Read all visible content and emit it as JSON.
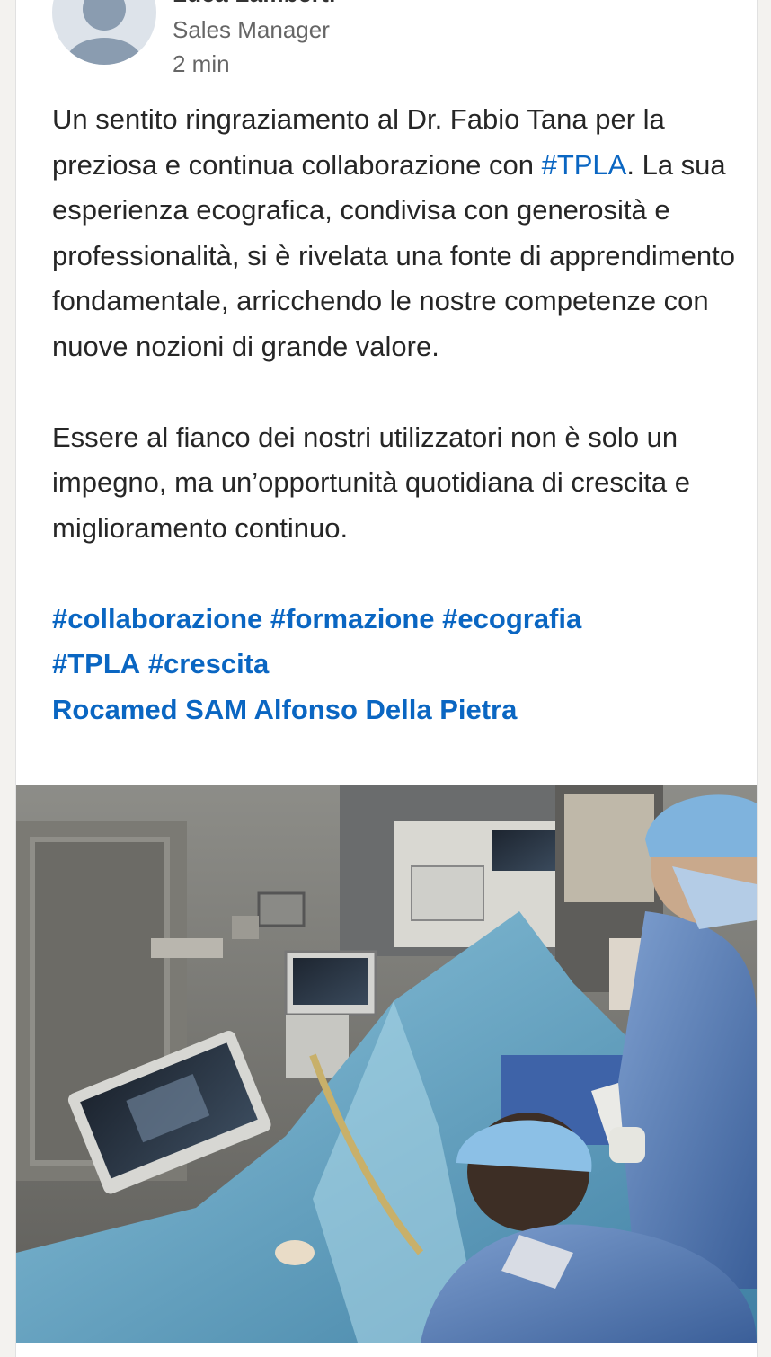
{
  "post": {
    "author_name": "Luca Lamberti",
    "author_title": "Sales Manager",
    "timestamp": "2 min",
    "text": {
      "p1_part1": "Un sentito ringraziamento al Dr. Fabio Tana per la preziosa e continua collaborazione con ",
      "p1_hashtag": "#TPLA",
      "p1_part2": ". La sua esperienza ecografica, condivisa con generosità e professionalità, si è rivelata una fonte di apprendimento fondamentale, arricchendo le nostre competenze con nuove nozioni di grande valore.",
      "p2": "Essere al fianco dei nostri utilizzatori non è solo un impegno, ma un’opportunità quotidiana di crescita e miglioramento continuo.",
      "hashtags": [
        "#collaborazione",
        "#formazione",
        "#ecografia",
        "#TPLA",
        "#crescita"
      ],
      "mention": "Rocamed SAM Alfonso Della Pietra"
    }
  },
  "colors": {
    "link": "#0a66c2",
    "text": "#262626",
    "muted": "#666666"
  }
}
